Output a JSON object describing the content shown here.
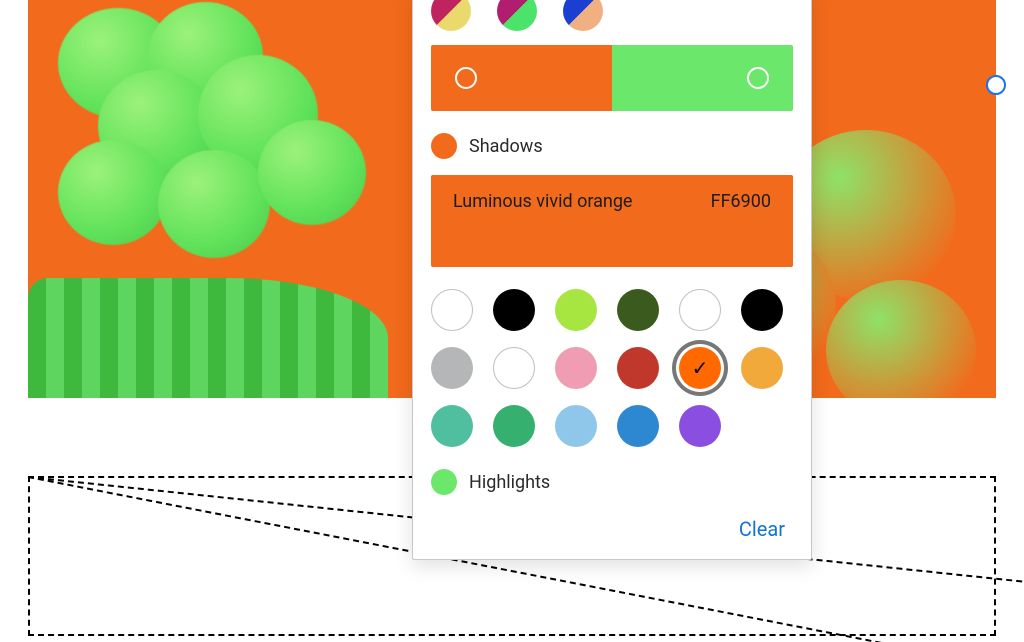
{
  "duotone": {
    "shadows_label": "Shadows",
    "highlights_label": "Highlights",
    "shadows_color": "#F26A1B",
    "highlights_color": "#6BE86B",
    "presets": [
      {
        "name": "preset-red-yellow",
        "a": "#C0245E",
        "b": "#EADA6E"
      },
      {
        "name": "preset-magenta-green",
        "a": "#B11E6F",
        "b": "#4BE36A"
      },
      {
        "name": "preset-blue-peach",
        "a": "#1B3FD0",
        "b": "#F0B082"
      }
    ],
    "current": {
      "name": "Luminous vivid orange",
      "hex": "FF6900",
      "bg": "#F26A1B"
    },
    "swatches": [
      {
        "name": "swatch-white-1",
        "hex": "#FFFFFF",
        "outlined": true
      },
      {
        "name": "swatch-black-1",
        "hex": "#000000"
      },
      {
        "name": "swatch-lime",
        "hex": "#A7E641"
      },
      {
        "name": "swatch-dark-olive",
        "hex": "#3A5A1E"
      },
      {
        "name": "swatch-white-2",
        "hex": "#FFFFFF",
        "outlined": true
      },
      {
        "name": "swatch-black-2",
        "hex": "#000000"
      },
      {
        "name": "swatch-gray",
        "hex": "#B4B6B8"
      },
      {
        "name": "swatch-white-3",
        "hex": "#FFFFFF",
        "outlined": true
      },
      {
        "name": "swatch-pink",
        "hex": "#F09CB2"
      },
      {
        "name": "swatch-brick",
        "hex": "#C0372C"
      },
      {
        "name": "swatch-lvorange",
        "hex": "#FF6900",
        "selected": true
      },
      {
        "name": "swatch-amber",
        "hex": "#F2A93C"
      },
      {
        "name": "swatch-teal",
        "hex": "#4FBFA0"
      },
      {
        "name": "swatch-green",
        "hex": "#35B06F"
      },
      {
        "name": "swatch-sky",
        "hex": "#8FC7EA"
      },
      {
        "name": "swatch-blue",
        "hex": "#2E88D1"
      },
      {
        "name": "swatch-violet",
        "hex": "#8A4FE0"
      }
    ],
    "clear_label": "Clear"
  }
}
